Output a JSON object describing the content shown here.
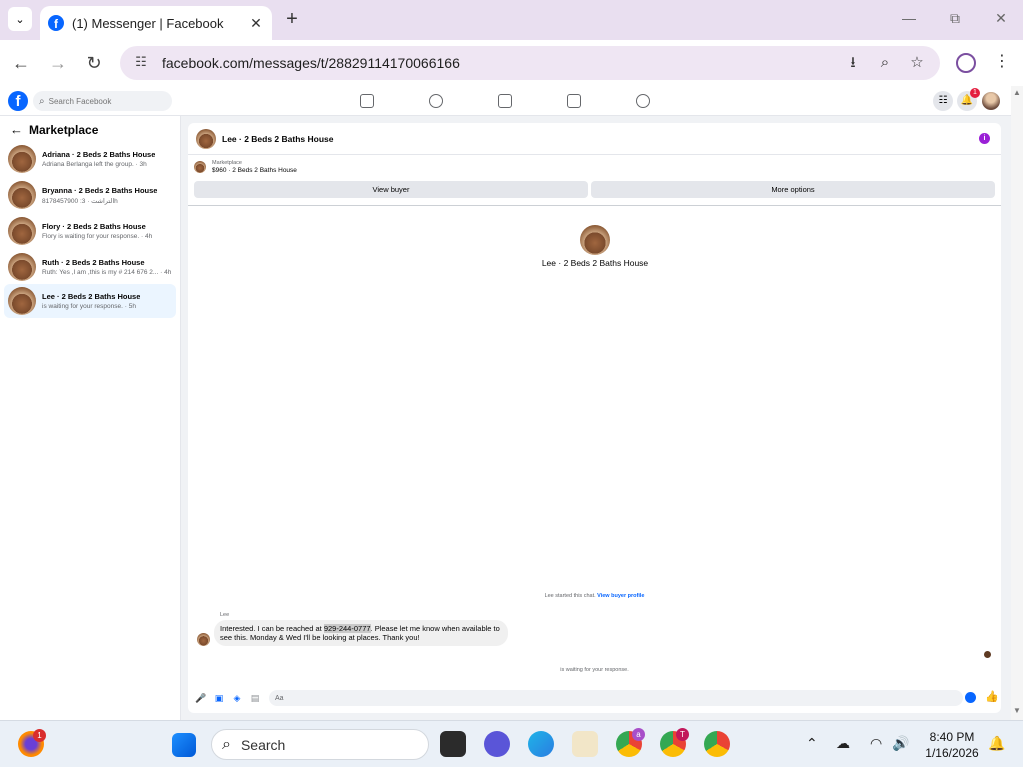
{
  "browser": {
    "tab_title": "(1) Messenger | Facebook",
    "url": "facebook.com/messages/t/28829114170066166"
  },
  "fb": {
    "search_placeholder": "Search Facebook",
    "notifications_count": "1"
  },
  "sidebar": {
    "title": "Marketplace",
    "conversations": [
      {
        "name": "Adriana · 2 Beds 2 Baths House",
        "preview": "Adriana Berlanga left the group. · 3h"
      },
      {
        "name": "Bryanna · 2 Beds 2 Baths House",
        "preview": "8178457900 :التراشت · 3h"
      },
      {
        "name": "Flory · 2 Beds 2 Baths House",
        "preview": "Flory is waiting for your response. · 4h"
      },
      {
        "name": "Ruth · 2 Beds 2 Baths House",
        "preview": "Ruth: Yes ,I am ,this is my # 214 676 2... · 4h"
      },
      {
        "name": "Lee · 2 Beds 2 Baths House",
        "preview": "is waiting for your response. · 5h"
      }
    ]
  },
  "chat": {
    "title": "Lee · 2 Beds 2 Baths House",
    "marketplace_label": "Marketplace",
    "listing": "$960 · 2 Beds 2 Baths House",
    "view_buyer": "View buyer",
    "more_options": "More options",
    "center_name": "Lee · 2 Beds 2 Baths House",
    "started_text": "Lee started this chat.",
    "view_buyer_profile": "View buyer profile",
    "sender": "Lee",
    "message_pre": "Interested. I can be reached at ",
    "message_phone": "929-244-0777",
    "message_post": ". Please let me know when available to see this. Monday & Wed I'll be looking at places. Thank you!",
    "waiting": "is waiting for your response.",
    "composer_placeholder": "Aa"
  },
  "taskbar": {
    "search_label": "Search",
    "badge_firefox": "1",
    "badge_chrome_a": "a",
    "badge_chrome_t": "T",
    "time": "8:40 PM",
    "date": "1/16/2026"
  },
  "colors": {
    "fb_blue": "#0866ff",
    "active_conv": "#ebf5ff",
    "info_purple": "#9a1fd6"
  }
}
